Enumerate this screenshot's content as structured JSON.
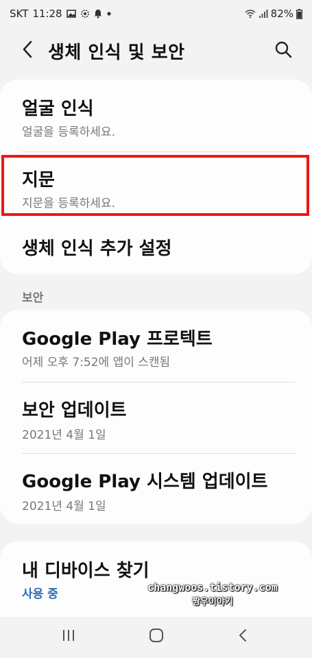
{
  "status_bar": {
    "carrier": "SKT",
    "time": "11:28",
    "battery": "82%",
    "icons": [
      "gallery-icon",
      "sync-icon",
      "notification-icon",
      "dot-icon",
      "wifi-icon",
      "signal-icon",
      "battery-icon"
    ]
  },
  "header": {
    "title": "생체 인식 및 보안",
    "back_icon": "back-arrow-icon",
    "search_icon": "search-icon"
  },
  "biometrics": {
    "items": [
      {
        "title": "얼굴 인식",
        "subtitle": "얼굴을 등록하세요."
      },
      {
        "title": "지문",
        "subtitle": "지문을 등록하세요.",
        "highlighted": true
      },
      {
        "title": "생체 인식 추가 설정"
      }
    ]
  },
  "security": {
    "section_label": "보안",
    "items": [
      {
        "title": "Google Play 프로텍트",
        "subtitle": "어제 오후 7:52에 앱이 스캔됨"
      },
      {
        "title": "보안 업데이트",
        "subtitle": "2021년 4월 1일"
      },
      {
        "title": "Google Play 시스템 업데이트",
        "subtitle": "2021년 4월 1일"
      }
    ]
  },
  "find_device": {
    "title": "내 디바이스 찾기",
    "status": "사용 중",
    "status_color": "#2c6bb3"
  },
  "watermark": {
    "line1": "changwoos.tistory.com",
    "line2": "짱우이야기"
  },
  "nav_bar": {
    "recents_icon": "recents-icon",
    "home_icon": "home-icon",
    "back_icon": "nav-back-icon"
  },
  "colors": {
    "background": "#f3f3f3",
    "card": "#fdfdfd",
    "highlight": "#f01414",
    "accent": "#2c6bb3"
  }
}
